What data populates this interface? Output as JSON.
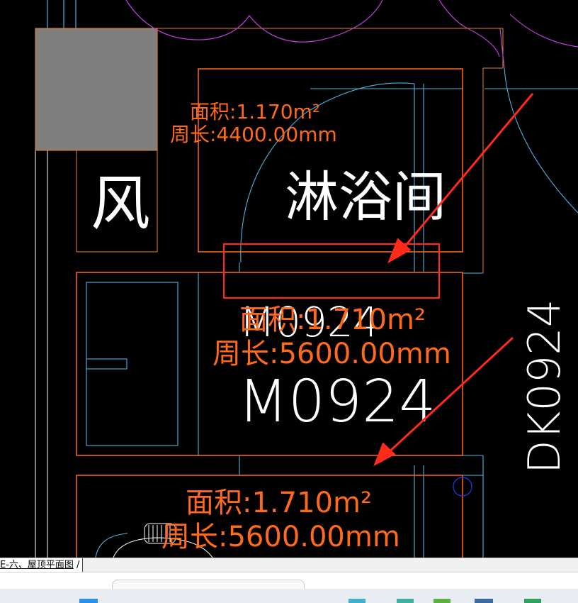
{
  "drawing": {
    "room_name": "淋浴间",
    "room_name_left": "风",
    "door_labels": [
      "M0924",
      "M0924",
      "DK0924"
    ],
    "area_blocks": [
      {
        "area": "面积:1.170m²",
        "perimeter": "周长:4400.00mm"
      },
      {
        "area": "面积:1.710m²",
        "perimeter": "周长:5600.00mm"
      },
      {
        "area": "面积:1.710m²",
        "perimeter": "周长:5600.00mm"
      }
    ]
  },
  "colors": {
    "background": "#000000",
    "wall_orange": "#ff6a1a",
    "thin_orange": "#e8862a",
    "line_cyan": "#4fb3e0",
    "arc_magenta": "#c13ee0",
    "annotation_red": "#ff2a1a",
    "fill_gray": "#7f7f7f",
    "text_white": "#ffffff"
  },
  "layout_tabs": {
    "active": "E-六、屋顶平面图"
  }
}
